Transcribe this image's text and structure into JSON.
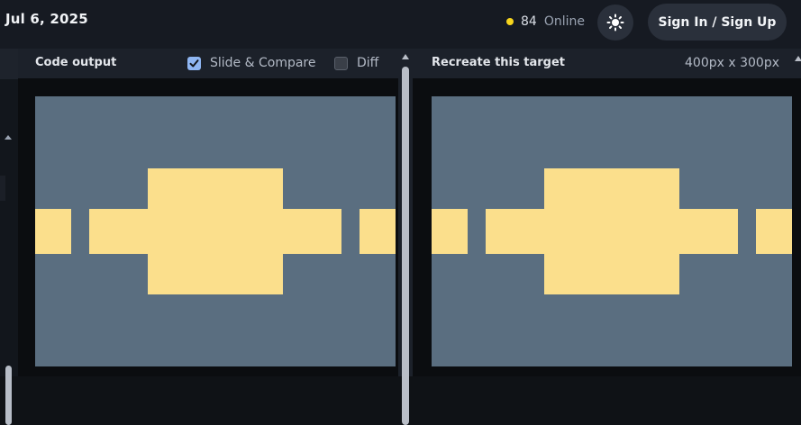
{
  "header": {
    "date": "Jul 6, 2025",
    "online_count": "84",
    "online_label": "Online",
    "signin_label": "Sign In / Sign Up"
  },
  "code_panel": {
    "title": "Code output",
    "slide_compare_label": "Slide & Compare",
    "slide_compare_checked": true,
    "diff_label": "Diff",
    "diff_checked": false
  },
  "target_panel": {
    "title": "Recreate this target",
    "dimensions": "400px x 300px"
  },
  "colors": {
    "canvas_bg": "#5a6e80",
    "shape_fill": "#fbdf8c",
    "online_dot": "#f7d51d",
    "checkbox_on": "#8fb6f2"
  },
  "icons": {
    "theme": "sun-icon",
    "checkbox_on": "check-icon"
  }
}
